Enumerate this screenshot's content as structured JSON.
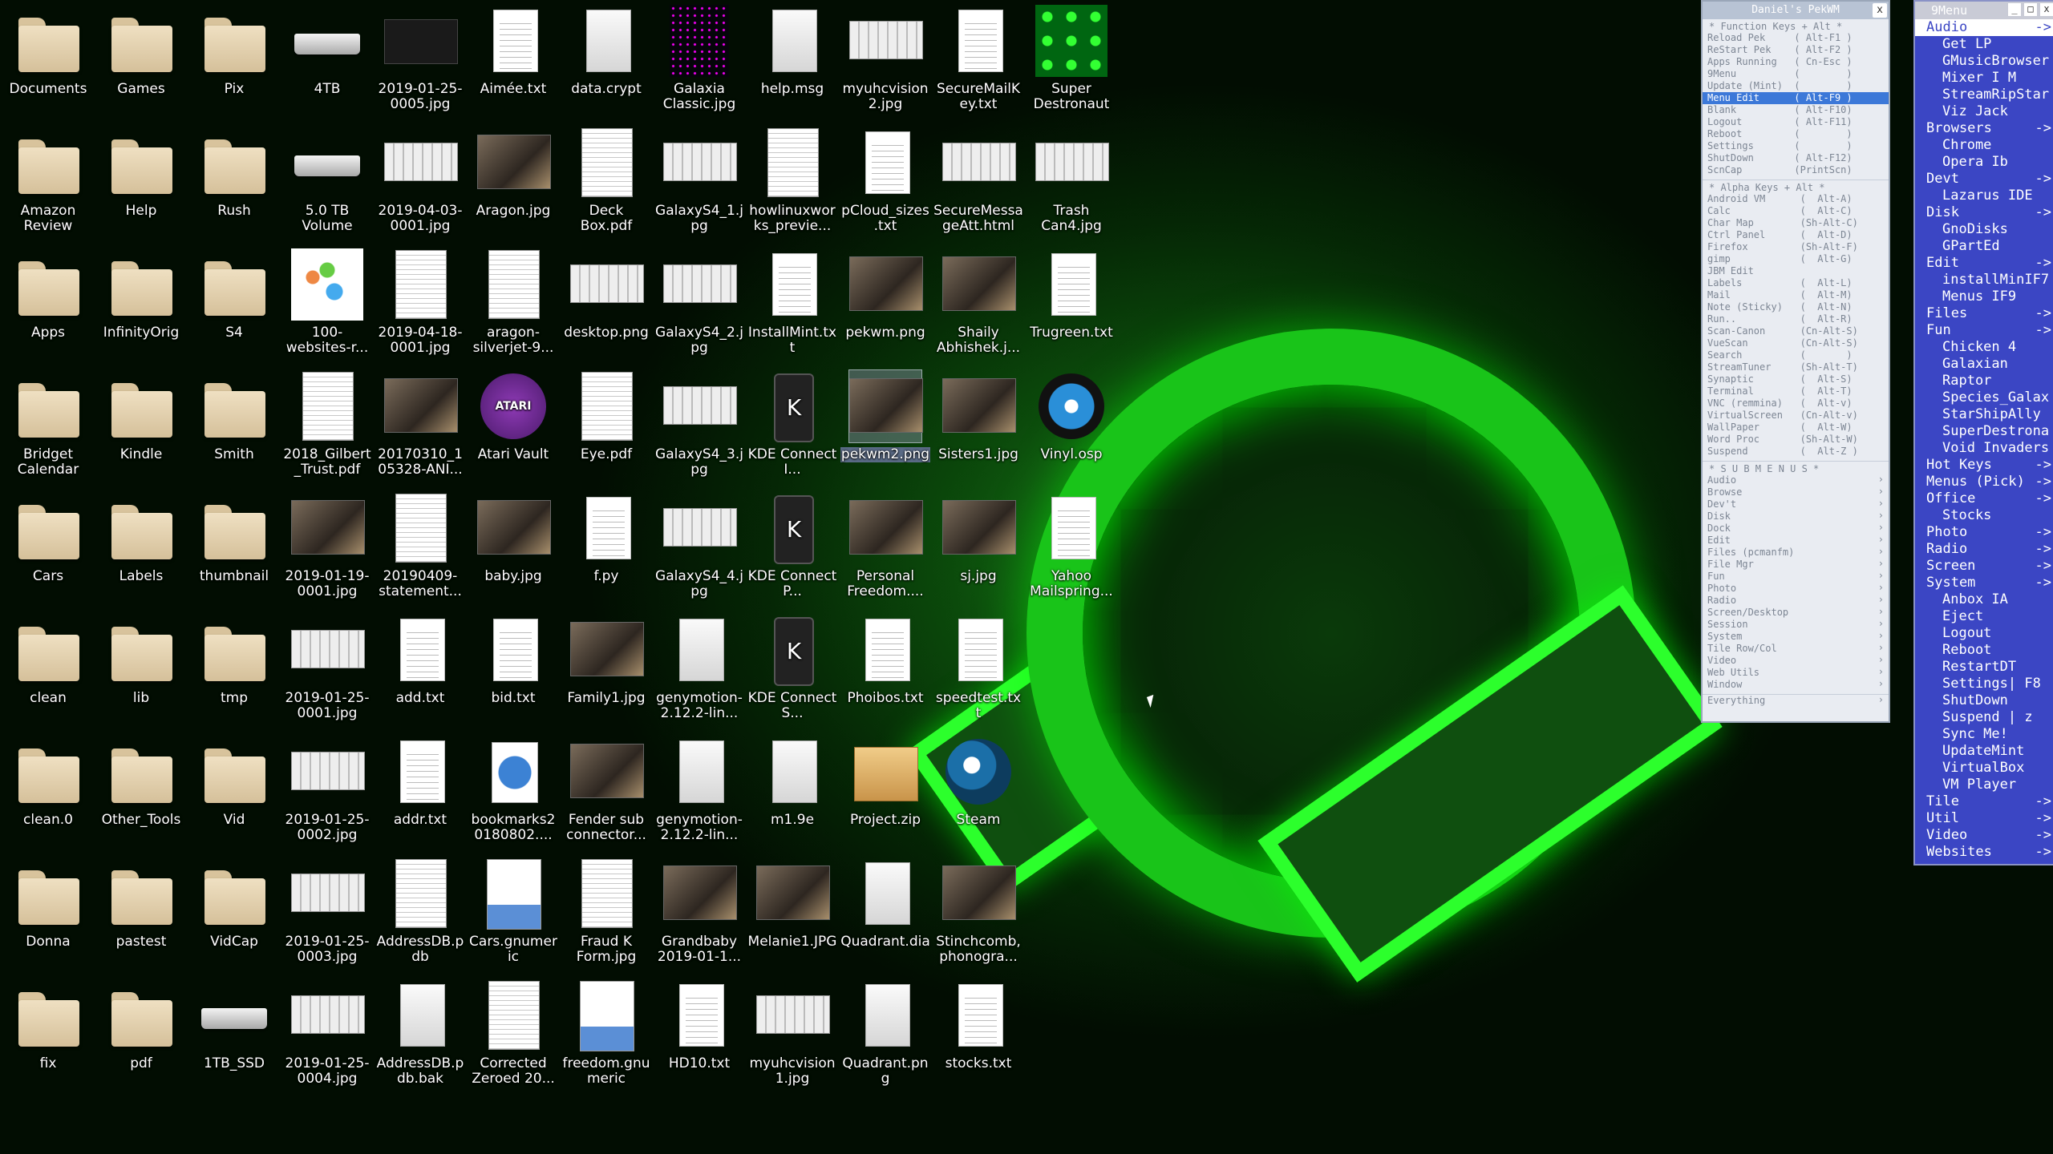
{
  "wallpaper": {
    "accent": "#19c419",
    "background": "#052705"
  },
  "desktop_columns": [
    [
      {
        "label": "Documents",
        "kind": "folder"
      },
      {
        "label": "Amazon Review",
        "kind": "folder"
      },
      {
        "label": "Apps",
        "kind": "folder"
      },
      {
        "label": "Bridget Calendar",
        "kind": "folder"
      },
      {
        "label": "Cars",
        "kind": "folder"
      },
      {
        "label": "clean",
        "kind": "folder"
      },
      {
        "label": "clean.0",
        "kind": "folder"
      },
      {
        "label": "Donna",
        "kind": "folder"
      },
      {
        "label": "fix",
        "kind": "folder"
      }
    ],
    [
      {
        "label": "Games",
        "kind": "folder"
      },
      {
        "label": "Help",
        "kind": "folder"
      },
      {
        "label": "InfinityOrig",
        "kind": "folder"
      },
      {
        "label": "Kindle",
        "kind": "folder"
      },
      {
        "label": "Labels",
        "kind": "folder"
      },
      {
        "label": "lib",
        "kind": "folder"
      },
      {
        "label": "Other_Tools",
        "kind": "folder"
      },
      {
        "label": "pastest",
        "kind": "folder"
      },
      {
        "label": "pdf",
        "kind": "folder"
      }
    ],
    [
      {
        "label": "Pix",
        "kind": "folder"
      },
      {
        "label": "Rush",
        "kind": "folder"
      },
      {
        "label": "S4",
        "kind": "folder"
      },
      {
        "label": "Smith",
        "kind": "folder"
      },
      {
        "label": "thumbnail",
        "kind": "folder"
      },
      {
        "label": "tmp",
        "kind": "folder"
      },
      {
        "label": "Vid",
        "kind": "folder"
      },
      {
        "label": "VidCap",
        "kind": "folder"
      },
      {
        "label": "1TB_SSD",
        "kind": "drive"
      }
    ],
    [
      {
        "label": "4TB",
        "kind": "drive"
      },
      {
        "label": "5.0 TB Volume",
        "kind": "drive"
      },
      {
        "label": "100-websites-r...",
        "kind": "wsite"
      },
      {
        "label": "2018_Gilbert_Trust.pdf",
        "kind": "page"
      },
      {
        "label": "2019-01-19-0001.jpg",
        "kind": "photo"
      },
      {
        "label": "2019-01-25-0001.jpg",
        "kind": "shot"
      },
      {
        "label": "2019-01-25-0002.jpg",
        "kind": "shot"
      },
      {
        "label": "2019-01-25-0003.jpg",
        "kind": "shot"
      },
      {
        "label": "2019-01-25-0004.jpg",
        "kind": "shot"
      }
    ],
    [
      {
        "label": "2019-01-25-0005.jpg",
        "kind": "dark"
      },
      {
        "label": "2019-04-03-0001.jpg",
        "kind": "shot"
      },
      {
        "label": "2019-04-18-0001.jpg",
        "kind": "page"
      },
      {
        "label": "20170310_105328-ANI...",
        "kind": "photo"
      },
      {
        "label": "20190409-statement...",
        "kind": "page"
      },
      {
        "label": "add.txt",
        "kind": "doc"
      },
      {
        "label": "addr.txt",
        "kind": "doc"
      },
      {
        "label": "AddressDB.pdb",
        "kind": "page"
      },
      {
        "label": "AddressDB.pdb.bak",
        "kind": "blank"
      }
    ],
    [
      {
        "label": "Aimée.txt",
        "kind": "doc"
      },
      {
        "label": "Aragon.jpg",
        "kind": "photo"
      },
      {
        "label": "aragon-silverjet-9...",
        "kind": "page"
      },
      {
        "label": "Atari Vault",
        "kind": "atari"
      },
      {
        "label": "baby.jpg",
        "kind": "photo"
      },
      {
        "label": "bid.txt",
        "kind": "doc"
      },
      {
        "label": "bookmarks20180802....",
        "kind": "globe"
      },
      {
        "label": "Cars.gnumeric",
        "kind": "chart"
      },
      {
        "label": "Corrected Zeroed 20...",
        "kind": "page"
      }
    ],
    [
      {
        "label": "data.crypt",
        "kind": "blank"
      },
      {
        "label": "Deck Box.pdf",
        "kind": "page"
      },
      {
        "label": "desktop.png",
        "kind": "shot"
      },
      {
        "label": "Eye.pdf",
        "kind": "page"
      },
      {
        "label": "f.py",
        "kind": "doc"
      },
      {
        "label": "Family1.jpg",
        "kind": "photo"
      },
      {
        "label": "Fender sub connector...",
        "kind": "photo"
      },
      {
        "label": "Fraud K Form.jpg",
        "kind": "page"
      },
      {
        "label": "freedom.gnumeric",
        "kind": "chart"
      }
    ],
    [
      {
        "label": "Galaxia Classic.jpg",
        "kind": "game"
      },
      {
        "label": "GalaxyS4_1.jpg",
        "kind": "shot"
      },
      {
        "label": "GalaxyS4_2.jpg",
        "kind": "shot"
      },
      {
        "label": "GalaxyS4_3.jpg",
        "kind": "shot"
      },
      {
        "label": "GalaxyS4_4.jpg",
        "kind": "shot"
      },
      {
        "label": "genymotion-2.12.2-lin...",
        "kind": "blank"
      },
      {
        "label": "genymotion-2.12.2-lin...",
        "kind": "blank"
      },
      {
        "label": "Grandbaby 2019-01-1...",
        "kind": "photo"
      },
      {
        "label": "HD10.txt",
        "kind": "doc"
      }
    ],
    [
      {
        "label": "help.msg",
        "kind": "blank"
      },
      {
        "label": "howlinuxworks_previe...",
        "kind": "page"
      },
      {
        "label": "InstallMint.txt",
        "kind": "doc"
      },
      {
        "label": "KDE Connect I...",
        "kind": "kde"
      },
      {
        "label": "KDE Connect P...",
        "kind": "kde"
      },
      {
        "label": "KDE Connect S...",
        "kind": "kde"
      },
      {
        "label": "m1.9e",
        "kind": "blank"
      },
      {
        "label": "Melanie1.JPG",
        "kind": "photo"
      },
      {
        "label": "myuhcvision1.jpg",
        "kind": "shot"
      }
    ],
    [
      {
        "label": "myuhcvision2.jpg",
        "kind": "shot"
      },
      {
        "label": "pCloud_sizes.txt",
        "kind": "doc"
      },
      {
        "label": "pekwm.png",
        "kind": "photo"
      },
      {
        "label": "pekwm2.png",
        "kind": "photo",
        "selected": true
      },
      {
        "label": "Personal Freedom....",
        "kind": "photo"
      },
      {
        "label": "Phoibos.txt",
        "kind": "doc"
      },
      {
        "label": "Project.zip",
        "kind": "zip"
      },
      {
        "label": "Quadrant.dia",
        "kind": "blank"
      },
      {
        "label": "Quadrant.png",
        "kind": "blank"
      }
    ],
    [
      {
        "label": "SecureMailKey.txt",
        "kind": "doc"
      },
      {
        "label": "SecureMessageAtt.html",
        "kind": "shot"
      },
      {
        "label": "Shaily Abhishek.j...",
        "kind": "photo"
      },
      {
        "label": "Sisters1.jpg",
        "kind": "photo"
      },
      {
        "label": "sj.jpg",
        "kind": "photo"
      },
      {
        "label": "speedtest.txt",
        "kind": "doc"
      },
      {
        "label": "Steam",
        "kind": "steam"
      },
      {
        "label": "Stinchcomb, phonogra...",
        "kind": "photo"
      },
      {
        "label": "stocks.txt",
        "kind": "doc"
      }
    ],
    [
      {
        "label": "Super Destronaut",
        "kind": "alien"
      },
      {
        "label": "Trash Can4.jpg",
        "kind": "shot"
      },
      {
        "label": "Trugreen.txt",
        "kind": "doc"
      },
      {
        "label": "Vinyl.osp",
        "kind": "vinyl"
      },
      {
        "label": "Yahoo Mailspring...",
        "kind": "doc"
      }
    ]
  ],
  "pekwm_menu": {
    "title": "Daniel's PekWM",
    "close": "x",
    "function_header": "* Function Keys + Alt *",
    "function_rows": [
      "Reload Pek     ( Alt-F1 )",
      "ReStart Pek    ( Alt-F2 )",
      "Apps Running   ( Cn-Esc )",
      "9Menu          (        )",
      "Update (Mint)  (        )",
      "Menu Edit      ( Alt-F9 )",
      "Blank          ( Alt-F10)",
      "Logout         ( Alt-F11)",
      "Reboot         (        )",
      "Settings       (        )",
      "ShutDown       ( Alt-F12)",
      "ScnCap         (PrintScn)"
    ],
    "function_highlight_index": 5,
    "alpha_header": "* Alpha Keys + Alt *",
    "alpha_rows": [
      "Android VM      (  Alt-A)",
      "Calc            (  Alt-C)",
      "Char Map        (Sh-Alt-C)",
      "Ctrl Panel      (  Alt-D)",
      "Firefox         (Sh-Alt-F)",
      "gimp            (  Alt-G)",
      "JBM Edit",
      "Labels          (  Alt-L)",
      "Mail            (  Alt-M)",
      "Note (Sticky)   (  Alt-N)",
      "Run..           (  Alt-R)",
      "Scan-Canon      (Cn-Alt-S)",
      "VueScan         (Cn-Alt-S)",
      "Search          (       )",
      "StreamTuner     (Sh-Alt-T)",
      "Synaptic        (  Alt-S)",
      "Terminal        (  Alt-T)",
      "VNC (remmina)   (  Alt-v)",
      "VirtualScreen   (Cn-Alt-v)",
      "WallPaper       (  Alt-W)",
      "Word Proc       (Sh-Alt-W)",
      "Suspend         (  Alt-Z )"
    ],
    "submenus_header": "* S U B M E N U S *",
    "submenus": [
      "Audio",
      "Browse",
      "Dev't",
      "Disk",
      "Dock",
      "Edit",
      "Files (pcmanfm)",
      "File Mgr",
      "Fun",
      "Photo",
      "Radio",
      "Screen/Desktop",
      "Session",
      "System",
      "Tile Row/Col",
      "Video",
      "Web Utils",
      "Window"
    ],
    "everything": "Everything"
  },
  "nine_menu": {
    "title": "9Menu",
    "buttons": [
      "_",
      "□",
      "x"
    ],
    "items": [
      {
        "label": "Audio",
        "arrow": "->",
        "selected": true
      },
      {
        "label": "Get LP",
        "indent": true
      },
      {
        "label": "GMusicBrowser",
        "indent": true
      },
      {
        "label": "Mixer        I M",
        "indent": true
      },
      {
        "label": "StreamRipStar",
        "indent": true
      },
      {
        "label": "Viz Jack",
        "indent": true
      },
      {
        "label": "Browsers",
        "arrow": "->"
      },
      {
        "label": "Chrome",
        "indent": true
      },
      {
        "label": "Opera        Ib",
        "indent": true
      },
      {
        "label": "Devt",
        "arrow": "->"
      },
      {
        "label": "Lazarus IDE",
        "indent": true
      },
      {
        "label": "Disk",
        "arrow": "->"
      },
      {
        "label": "GnoDisks",
        "indent": true
      },
      {
        "label": "GPartEd",
        "indent": true
      },
      {
        "label": "Edit",
        "arrow": "->"
      },
      {
        "label": "installMinIF7",
        "indent": true
      },
      {
        "label": "Menus       IF9",
        "indent": true
      },
      {
        "label": "Files",
        "arrow": "->"
      },
      {
        "label": "Fun",
        "arrow": "->"
      },
      {
        "label": "Chicken 4",
        "indent": true
      },
      {
        "label": "Galaxian",
        "indent": true
      },
      {
        "label": "Raptor",
        "indent": true
      },
      {
        "label": "Species_Galax",
        "indent": true
      },
      {
        "label": "StarShipAlly",
        "indent": true
      },
      {
        "label": "SuperDestrona",
        "indent": true
      },
      {
        "label": "Void Invaders",
        "indent": true
      },
      {
        "label": "Hot Keys",
        "arrow": "->"
      },
      {
        "label": "Menus (Pick)",
        "arrow": "->"
      },
      {
        "label": "Office",
        "arrow": "->"
      },
      {
        "label": "Stocks",
        "indent": true
      },
      {
        "label": "Photo",
        "arrow": "->"
      },
      {
        "label": "Radio",
        "arrow": "->"
      },
      {
        "label": "Screen",
        "arrow": "->"
      },
      {
        "label": "System",
        "arrow": "->"
      },
      {
        "label": "Anbox      IA",
        "indent": true
      },
      {
        "label": "Eject",
        "indent": true
      },
      {
        "label": "Logout",
        "indent": true
      },
      {
        "label": "Reboot",
        "indent": true
      },
      {
        "label": "RestartDT",
        "indent": true
      },
      {
        "label": "Settings| F8",
        "indent": true
      },
      {
        "label": "ShutDown",
        "indent": true
      },
      {
        "label": "Suspend |  z",
        "indent": true
      },
      {
        "label": "Sync Me!",
        "indent": true
      },
      {
        "label": "UpdateMint",
        "indent": true
      },
      {
        "label": "VirtualBox",
        "indent": true
      },
      {
        "label": "VM Player",
        "indent": true
      },
      {
        "label": "Tile",
        "arrow": "->"
      },
      {
        "label": "Util",
        "arrow": "->"
      },
      {
        "label": "Video",
        "arrow": "->"
      },
      {
        "label": "Websites",
        "arrow": "->"
      }
    ]
  }
}
